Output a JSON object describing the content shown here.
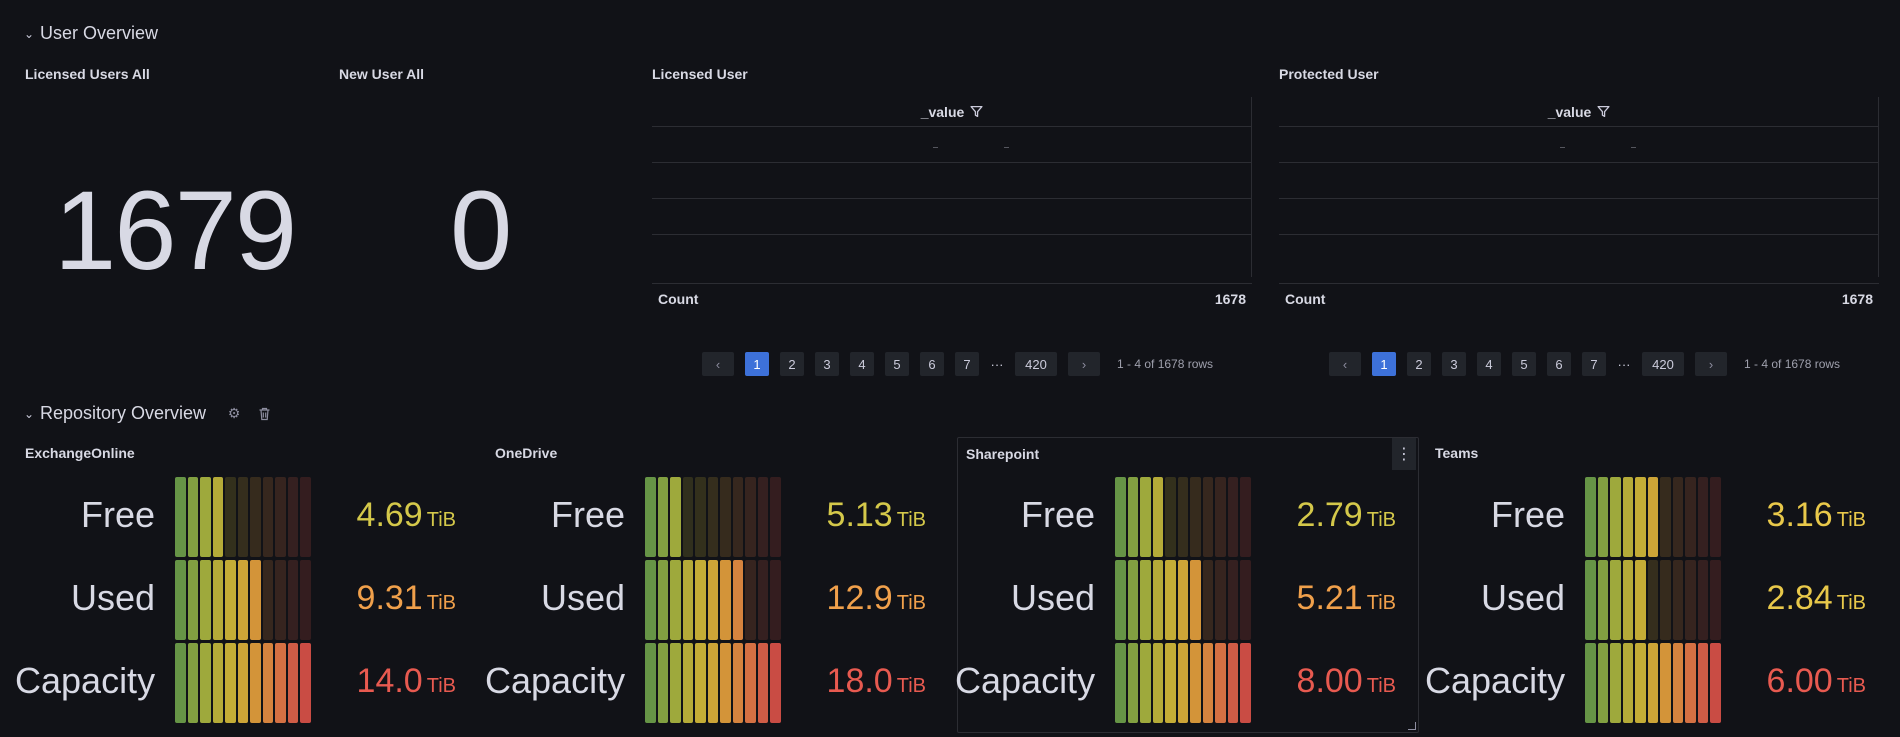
{
  "rows": {
    "user_overview": "User Overview",
    "repository_overview": "Repository Overview"
  },
  "stats": {
    "licensed_all": {
      "title": "Licensed Users All",
      "value": "1679"
    },
    "new_all": {
      "title": "New User All",
      "value": "0"
    }
  },
  "tables": [
    {
      "title": "Licensed User",
      "column": "_value",
      "footer_label": "Count",
      "footer_value": "1678",
      "pages": [
        "1",
        "2",
        "3",
        "4",
        "5",
        "6",
        "7"
      ],
      "ellipsis": "···",
      "last_page": "420",
      "summary": "1 - 4 of 1678 rows"
    },
    {
      "title": "Protected User",
      "column": "_value",
      "footer_label": "Count",
      "footer_value": "1678",
      "pages": [
        "1",
        "2",
        "3",
        "4",
        "5",
        "6",
        "7"
      ],
      "ellipsis": "···",
      "last_page": "420",
      "summary": "1 - 4 of 1678 rows"
    }
  ],
  "gauges": [
    {
      "title": "ExchangeOnline",
      "metrics": [
        {
          "label": "Free",
          "value": "4.69",
          "unit": "TiB",
          "fraction": 0.335,
          "color": "#d4c84a"
        },
        {
          "label": "Used",
          "value": "9.31",
          "unit": "TiB",
          "fraction": 0.665,
          "color": "#f0a04b"
        },
        {
          "label": "Capacity",
          "value": "14.0",
          "unit": "TiB",
          "fraction": 1.0,
          "color": "#e85a50"
        }
      ]
    },
    {
      "title": "OneDrive",
      "metrics": [
        {
          "label": "Free",
          "value": "5.13",
          "unit": "TiB",
          "fraction": 0.285,
          "color": "#d4c84a"
        },
        {
          "label": "Used",
          "value": "12.9",
          "unit": "TiB",
          "fraction": 0.717,
          "color": "#f0a04b"
        },
        {
          "label": "Capacity",
          "value": "18.0",
          "unit": "TiB",
          "fraction": 1.0,
          "color": "#e85a50"
        }
      ]
    },
    {
      "title": "Sharepoint",
      "metrics": [
        {
          "label": "Free",
          "value": "2.79",
          "unit": "TiB",
          "fraction": 0.349,
          "color": "#d4c84a"
        },
        {
          "label": "Used",
          "value": "5.21",
          "unit": "TiB",
          "fraction": 0.651,
          "color": "#f0a04b"
        },
        {
          "label": "Capacity",
          "value": "8.00",
          "unit": "TiB",
          "fraction": 1.0,
          "color": "#e85a50"
        }
      ]
    },
    {
      "title": "Teams",
      "metrics": [
        {
          "label": "Free",
          "value": "3.16",
          "unit": "TiB",
          "fraction": 0.527,
          "color": "#e8c84a"
        },
        {
          "label": "Used",
          "value": "2.84",
          "unit": "TiB",
          "fraction": 0.473,
          "color": "#e8c84a"
        },
        {
          "label": "Capacity",
          "value": "6.00",
          "unit": "TiB",
          "fraction": 1.0,
          "color": "#e85a50"
        }
      ]
    }
  ],
  "colors": {
    "background": "#111217",
    "pager_active": "#3d71d9",
    "scale": [
      "#6ea04b",
      "#8cad45",
      "#aab640",
      "#c3b93c",
      "#d4ba3a",
      "#ddb13b",
      "#e4a03d",
      "#e68d42",
      "#e57848",
      "#e0634b",
      "#d95149"
    ]
  }
}
